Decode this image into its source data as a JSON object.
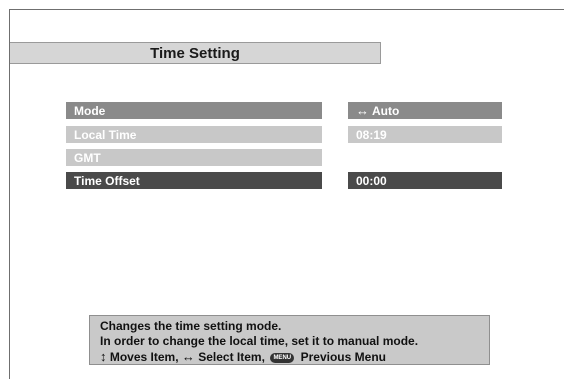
{
  "title": "Time Setting",
  "rows": [
    {
      "label": "Mode",
      "value": "Auto",
      "value_prefix_icon": "left-right-arrow"
    },
    {
      "label": "Local Time",
      "value": "08:19"
    },
    {
      "label": "GMT",
      "value": ""
    },
    {
      "label": "Time Offset",
      "value": "00:00"
    }
  ],
  "help": {
    "line1": "Changes the time setting mode.",
    "line2": "In order to change the local time, set it to manual mode.",
    "moves_item": "Moves Item,",
    "select_item": "Select Item,",
    "menu_icon_text": "MENU",
    "previous_menu": "Previous Menu"
  },
  "colors": {
    "row_active": "#8a8a8a",
    "row_disabled": "#c8c8c8",
    "row_selected": "#4a4a4a",
    "panel": "#c9c9c9"
  }
}
